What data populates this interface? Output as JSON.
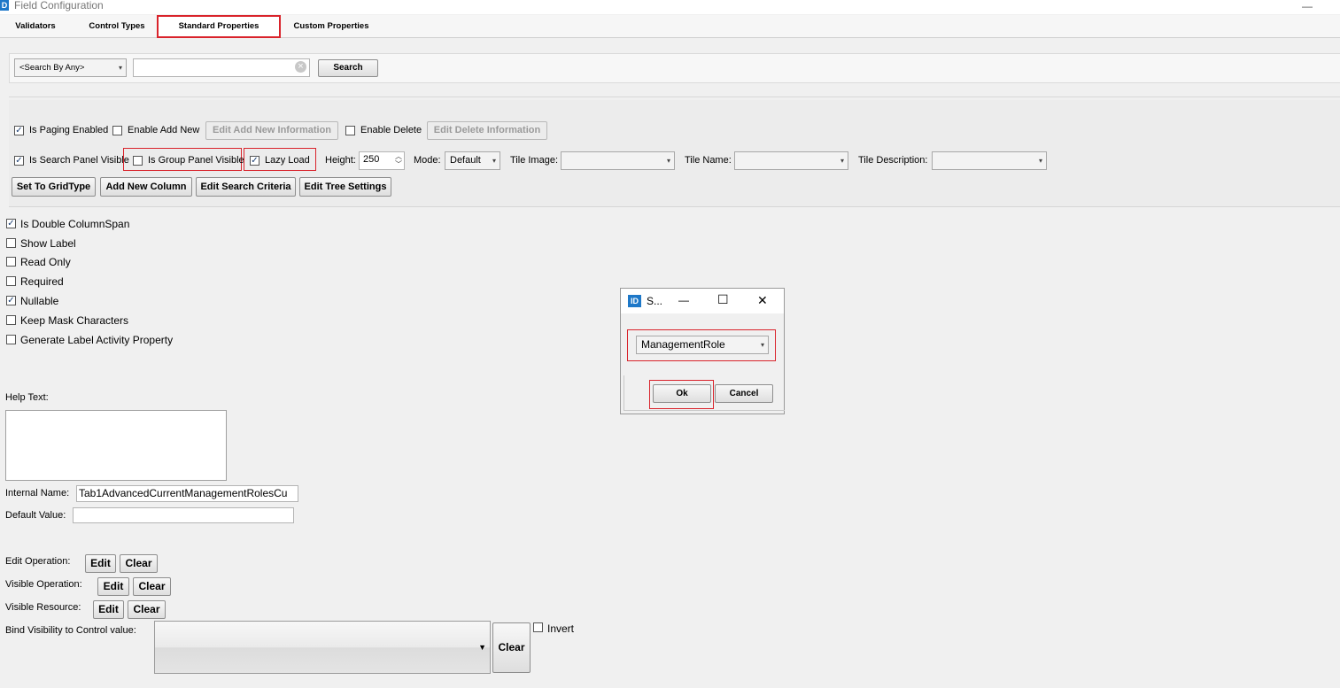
{
  "window": {
    "icon_text": "D",
    "title": "Field Configuration",
    "minimize_glyph": "—"
  },
  "tabs": [
    {
      "label": "Validators",
      "active": false
    },
    {
      "label": "Control Types",
      "active": false
    },
    {
      "label": "Standard Properties",
      "active": true
    },
    {
      "label": "Custom Properties",
      "active": false
    }
  ],
  "search": {
    "by_select_value": "<Search By Any>",
    "input_value": "",
    "clear_glyph": "×",
    "button_label": "Search"
  },
  "grid": {
    "is_paging_enabled": {
      "label": "Is Paging Enabled",
      "checked": true
    },
    "enable_add_new": {
      "label": "Enable Add New",
      "checked": false
    },
    "edit_add_new_info_label": "Edit Add New Information",
    "enable_delete": {
      "label": "Enable Delete",
      "checked": false
    },
    "edit_delete_info_label": "Edit Delete Information",
    "is_search_panel_visible": {
      "label": "Is Search Panel Visible",
      "checked": true
    },
    "is_group_panel_visible": {
      "label": "Is Group Panel Visible",
      "checked": false
    },
    "lazy_load": {
      "label": "Lazy Load",
      "checked": true
    },
    "height_label": "Height:",
    "height_value": "250",
    "mode_label": "Mode:",
    "mode_value": "Default",
    "tile_image_label": "Tile Image:",
    "tile_name_label": "Tile Name:",
    "tile_description_label": "Tile Description:",
    "buttons": {
      "set_to_gridtype": "Set To GridType",
      "add_new_column": "Add New Column",
      "edit_search_criteria": "Edit Search Criteria",
      "edit_tree_settings": "Edit Tree Settings"
    }
  },
  "options": [
    {
      "label": "Is Double ColumnSpan",
      "checked": true
    },
    {
      "label": "Show Label",
      "checked": false
    },
    {
      "label": "Read Only",
      "checked": false
    },
    {
      "label": "Required",
      "checked": false
    },
    {
      "label": "Nullable",
      "checked": true
    },
    {
      "label": "Keep Mask Characters",
      "checked": false
    },
    {
      "label": "Generate Label Activity Property",
      "checked": false
    }
  ],
  "help_text_label": "Help Text:",
  "internal_name_label": "Internal Name:",
  "internal_name_value": "Tab1AdvancedCurrentManagementRolesCu",
  "default_value_label": "Default Value:",
  "operations": {
    "edit_operation_label": "Edit Operation:",
    "visible_operation_label": "Visible Operation:",
    "visible_resource_label": "Visible Resource:",
    "edit_label": "Edit",
    "clear_label": "Clear"
  },
  "bind_visibility_label": "Bind Visibility to Control value:",
  "bind_clear_label": "Clear",
  "invert": {
    "label": "Invert",
    "checked": false
  },
  "dialog": {
    "icon_text": "ID",
    "title": "S...",
    "minimize_glyph": "—",
    "maximize_glyph": "☐",
    "close_glyph": "✕",
    "select_value": "ManagementRole",
    "ok_label": "Ok",
    "cancel_label": "Cancel"
  },
  "colors": {
    "highlight_red": "#d9232b",
    "checkbox_check": "#1c3f73",
    "icon_blue": "#1e78c8"
  }
}
